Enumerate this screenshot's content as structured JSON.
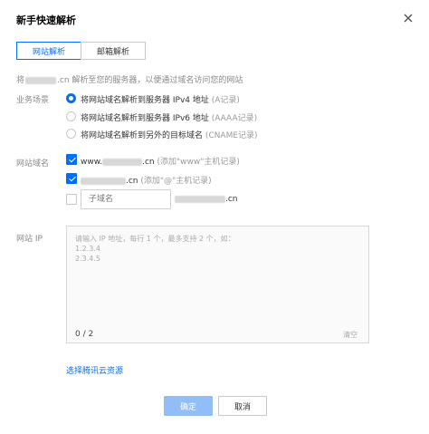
{
  "dialog": {
    "title": "新手快速解析"
  },
  "tabs": [
    {
      "label": "网站解析"
    },
    {
      "label": "邮箱解析"
    }
  ],
  "description": {
    "prefix": "将",
    "suffix": ".cn 解析至您的服务器，以便通过域名访问您的网站"
  },
  "business": {
    "label": "业务场景",
    "options": [
      {
        "text": "将网站域名解析到服务器 IPv4 地址",
        "hint": "(A记录)"
      },
      {
        "text": "将网站域名解析到服务器 IPv6 地址",
        "hint": "(AAAA记录)"
      },
      {
        "text": "将网站域名解析到另外的目标域名",
        "hint": "(CNAME记录)"
      }
    ]
  },
  "domain": {
    "label": "网站域名",
    "items": [
      {
        "prefix": "www.",
        "suffix": ".cn",
        "hint": "(添加\"www\"主机记录)"
      },
      {
        "prefix": "",
        "suffix": ".cn",
        "hint": "(添加\"@\"主机记录)"
      }
    ],
    "subdomain_placeholder": "子域名",
    "subdomain_suffix": ".cn"
  },
  "ip": {
    "label": "网站 IP",
    "placeholder": "请输入 IP 地址，每行 1 个，最多支持 2 个，如：\n1.2.3.4\n2.3.4.5",
    "counter": "0 / 2",
    "clear_label": "清空"
  },
  "resource_link": "选择腾讯云资源",
  "footer": {
    "confirm": "确定",
    "cancel": "取消"
  },
  "colors": {
    "accent": "#006eff",
    "confirm_disabled": "#92bdf6"
  }
}
